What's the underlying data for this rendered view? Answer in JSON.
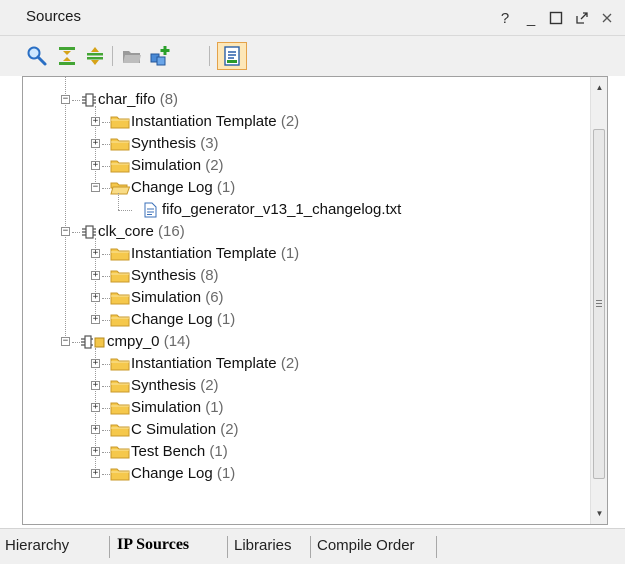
{
  "panel": {
    "title": "Sources",
    "controls": [
      "?",
      "_"
    ]
  },
  "toolbar": {
    "icons": [
      "search-icon",
      "collapse-all-icon",
      "expand-all-icon",
      "open-folder-icon",
      "add-sources-icon",
      "ip-properties-icon"
    ]
  },
  "tree": [
    {
      "label": "char_fifo",
      "count": "(8)",
      "level": 0,
      "type": "ip",
      "expanded": true
    },
    {
      "label": "Instantiation Template",
      "count": "(2)",
      "level": 1,
      "type": "folder",
      "expanded": false
    },
    {
      "label": "Synthesis",
      "count": "(3)",
      "level": 1,
      "type": "folder",
      "expanded": false
    },
    {
      "label": "Simulation",
      "count": "(2)",
      "level": 1,
      "type": "folder",
      "expanded": false
    },
    {
      "label": "Change Log",
      "count": "(1)",
      "level": 1,
      "type": "folder-open",
      "expanded": true
    },
    {
      "label": "fifo_generator_v13_1_changelog.txt",
      "count": "",
      "level": 2,
      "type": "file"
    },
    {
      "label": "clk_core",
      "count": "(16)",
      "level": 0,
      "type": "ip",
      "expanded": true
    },
    {
      "label": "Instantiation Template",
      "count": "(1)",
      "level": 1,
      "type": "folder",
      "expanded": false
    },
    {
      "label": "Synthesis",
      "count": "(8)",
      "level": 1,
      "type": "folder",
      "expanded": false
    },
    {
      "label": "Simulation",
      "count": "(6)",
      "level": 1,
      "type": "folder",
      "expanded": false
    },
    {
      "label": "Change Log",
      "count": "(1)",
      "level": 1,
      "type": "folder",
      "expanded": false
    },
    {
      "label": "cmpy_0",
      "count": "(14)",
      "level": 0,
      "type": "ip-block",
      "expanded": true
    },
    {
      "label": "Instantiation Template",
      "count": "(2)",
      "level": 1,
      "type": "folder",
      "expanded": false
    },
    {
      "label": "Synthesis",
      "count": "(2)",
      "level": 1,
      "type": "folder",
      "expanded": false
    },
    {
      "label": "Simulation",
      "count": "(1)",
      "level": 1,
      "type": "folder",
      "expanded": false
    },
    {
      "label": "C Simulation",
      "count": "(2)",
      "level": 1,
      "type": "folder",
      "expanded": false
    },
    {
      "label": "Test Bench",
      "count": "(1)",
      "level": 1,
      "type": "folder",
      "expanded": false
    },
    {
      "label": "Change Log",
      "count": "(1)",
      "level": 1,
      "type": "folder",
      "expanded": false
    }
  ],
  "tabs": [
    {
      "label": "Hierarchy",
      "active": false
    },
    {
      "label": "IP Sources",
      "active": true
    },
    {
      "label": "Libraries",
      "active": false
    },
    {
      "label": "Compile Order",
      "active": false
    }
  ],
  "colors": {
    "folder": "#f5c84c",
    "folder_edge": "#c9982a",
    "accent_active": "#fde7b8"
  }
}
